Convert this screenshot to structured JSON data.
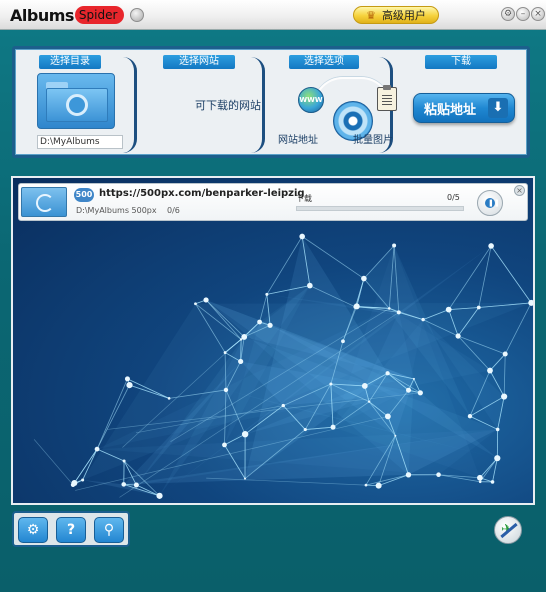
{
  "app": {
    "logo_main": "Albums",
    "logo_sub": "Spider",
    "vip_label": "高级用户"
  },
  "wizard": {
    "steps": [
      {
        "label": "选择目录"
      },
      {
        "label": "选择网站"
      },
      {
        "label": "选择选项"
      },
      {
        "label": "下载"
      }
    ],
    "directory_path": "D:\\MyAlbums",
    "downloadable_sites": "可下载的网站",
    "option_site_address": "网站地址",
    "option_batch_images": "批量图片",
    "paste_button": "粘贴地址",
    "globe_text": "WWW"
  },
  "task": {
    "site_badge": "500",
    "url": "https://500px.com/benparker-leipzig",
    "save_path": "D:\\MyAlbums 500px",
    "count": "0/6",
    "status": "下载",
    "progress_text": "0/5",
    "progress_fraction": 0
  },
  "toolbar": {
    "settings_icon": "gear-icon",
    "help_label": "?",
    "search_icon": "search-icon"
  },
  "colors": {
    "accent": "#1e82cc",
    "frame": "#1c5f8c",
    "background": "#0b6773"
  }
}
